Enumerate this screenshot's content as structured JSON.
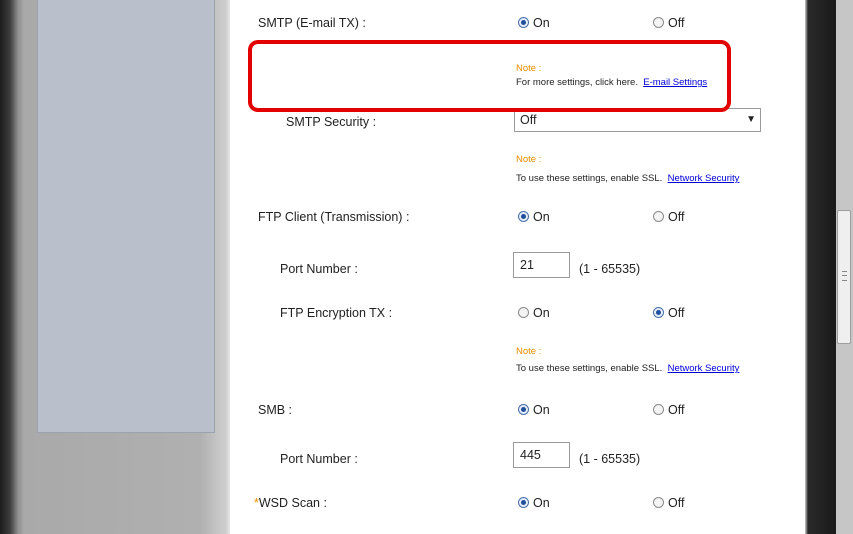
{
  "smtp": {
    "label": "SMTP (E-mail TX) :",
    "on_label": "On",
    "off_label": "Off",
    "selected": "On",
    "note_title": "Note :",
    "note_text": "For more settings, click here.",
    "note_link": "E-mail Settings"
  },
  "smtp_security": {
    "label": "SMTP Security :",
    "value": "Off",
    "note_title": "Note :",
    "note_text": "To use these settings, enable SSL.",
    "note_link": "Network Security"
  },
  "ftp_client": {
    "label": "FTP Client (Transmission) :",
    "on_label": "On",
    "off_label": "Off",
    "selected": "On"
  },
  "ftp_port": {
    "label": "Port Number :",
    "value": "21",
    "range": "(1 - 65535)"
  },
  "ftp_encryption": {
    "label": "FTP Encryption TX :",
    "on_label": "On",
    "off_label": "Off",
    "selected": "Off",
    "note_title": "Note :",
    "note_text": "To use these settings, enable SSL.",
    "note_link": "Network Security"
  },
  "smb": {
    "label": "SMB :",
    "on_label": "On",
    "off_label": "Off",
    "selected": "On"
  },
  "smb_port": {
    "label": "Port Number :",
    "value": "445",
    "range": "(1 - 65535)"
  },
  "wsd_scan": {
    "required_mark": "*",
    "label": "WSD Scan :",
    "on_label": "On",
    "off_label": "Off",
    "selected": "On"
  },
  "colors": {
    "note_title": "#f08c00",
    "link": "#0000d8",
    "highlight": "#e30000"
  }
}
